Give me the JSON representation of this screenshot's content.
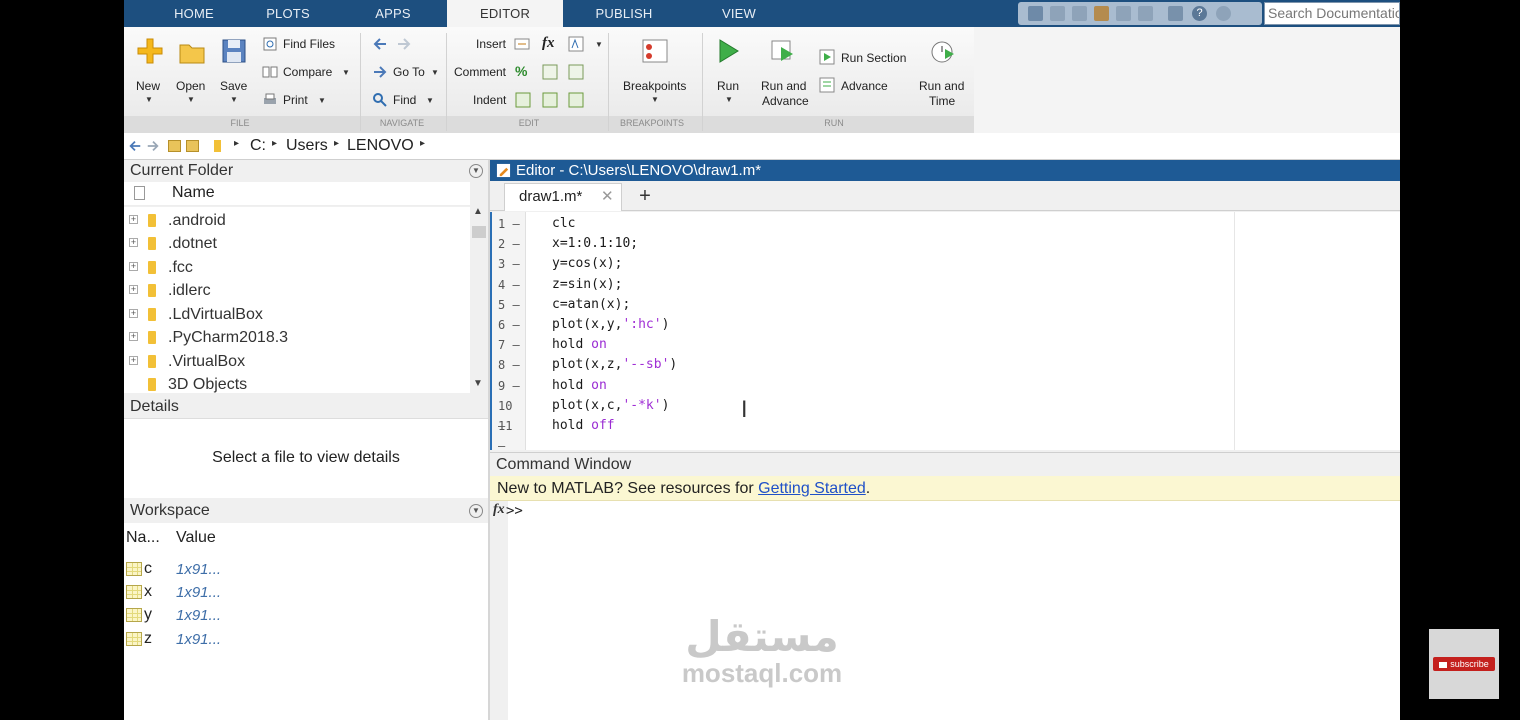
{
  "tabs": [
    "HOME",
    "PLOTS",
    "APPS",
    "EDITOR",
    "PUBLISH",
    "VIEW"
  ],
  "active_tab": "EDITOR",
  "search": {
    "placeholder": "Search Documentation"
  },
  "ribbon": {
    "file": {
      "new": "New",
      "open": "Open",
      "save": "Save",
      "find_files": "Find Files",
      "compare": "Compare",
      "print": "Print",
      "group": "FILE"
    },
    "navigate": {
      "go_to": "Go To",
      "find": "Find",
      "group": "NAVIGATE"
    },
    "edit": {
      "insert": "Insert",
      "comment": "Comment",
      "indent": "Indent",
      "fx": "fx",
      "comment_symbol": "%",
      "group": "EDIT"
    },
    "breakpoints": {
      "label": "Breakpoints",
      "group": "BREAKPOINTS"
    },
    "run": {
      "run": "Run",
      "run_and_advance_1": "Run and",
      "run_and_advance_2": "Advance",
      "run_section": "Run Section",
      "advance": "Advance",
      "run_and_time_1": "Run and",
      "run_and_time_2": "Time",
      "group": "RUN"
    }
  },
  "address": {
    "parts": [
      "C:",
      "Users",
      "LENOVO"
    ]
  },
  "current_folder": {
    "title": "Current Folder",
    "column": "Name",
    "items": [
      ".android",
      ".dotnet",
      ".fcc",
      ".idlerc",
      ".LdVirtualBox",
      ".PyCharm2018.3",
      ".VirtualBox",
      "3D Objects"
    ]
  },
  "details": {
    "title": "Details",
    "message": "Select a file to view details"
  },
  "workspace": {
    "title": "Workspace",
    "col_name": "Na...",
    "col_value": "Value",
    "vars": [
      {
        "name": "c",
        "value": "1x91..."
      },
      {
        "name": "x",
        "value": "1x91..."
      },
      {
        "name": "y",
        "value": "1x91..."
      },
      {
        "name": "z",
        "value": "1x91..."
      }
    ]
  },
  "editor": {
    "title": "Editor - C:\\Users\\LENOVO\\draw1.m*",
    "tab": "draw1.m*",
    "lines": [
      "clc",
      "x=1:0.1:10;",
      "y=cos(x);",
      "z=sin(x);",
      "c=atan(x);",
      "plot(x,y,':hc')",
      "hold on",
      "plot(x,z,'--sb')",
      "hold on",
      "plot(x,c,'-*k')",
      "hold off"
    ]
  },
  "command_window": {
    "title": "Command Window",
    "notice_prefix": "New to MATLAB? See resources for ",
    "notice_link": "Getting Started",
    "notice_suffix": ".",
    "prompt": ">>",
    "fx": "fx"
  },
  "watermark": {
    "arabic": "مستقل",
    "latin": "mostaql.com"
  },
  "subscribe": "subscribe",
  "colors": {
    "title_bar": "#1e5a95",
    "tab_bar": "#1d4f7f",
    "keyword": "#9a2bd3",
    "link": "#1f50c8",
    "notice_bg": "#fbf7d2"
  }
}
